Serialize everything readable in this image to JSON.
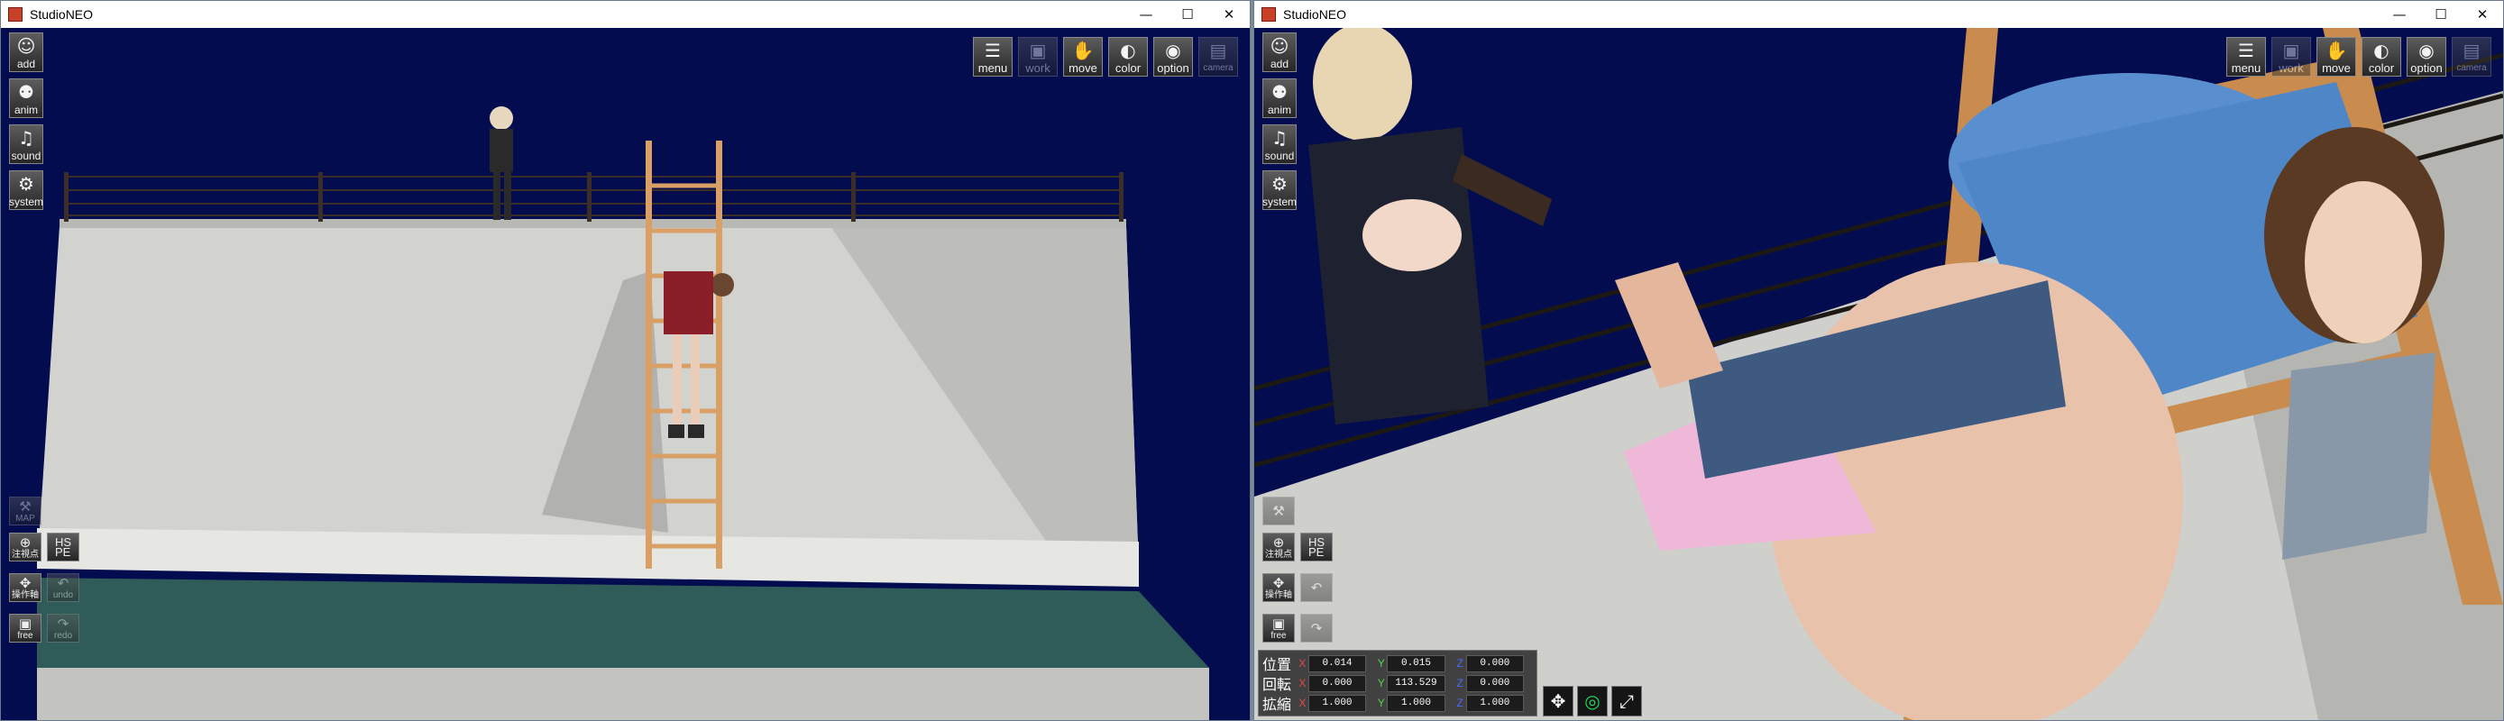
{
  "windows": [
    {
      "title": "StudioNEO",
      "controls": {
        "minimize": "—",
        "maximize": "☐",
        "close": "✕"
      },
      "left_toolbar": [
        {
          "label": "add",
          "icon": "person-add-icon",
          "glyph": "☺"
        },
        {
          "label": "anim",
          "icon": "running-figure-icon",
          "glyph": "⚉"
        },
        {
          "label": "sound",
          "icon": "music-note-icon",
          "glyph": "♫"
        },
        {
          "label": "system",
          "icon": "gears-icon",
          "glyph": "⚙"
        }
      ],
      "bottom_tools": {
        "map": "MAP",
        "center": "注視点",
        "hspe": "HS\nPE",
        "operation": "操作軸",
        "undo": "undo",
        "free": "free",
        "redo": "redo"
      },
      "top_toolbar": [
        {
          "label": "menu",
          "icon": "menu-list-icon",
          "glyph": "☰",
          "dim": false
        },
        {
          "label": "work",
          "icon": "work-icon",
          "glyph": "▣",
          "dim": true
        },
        {
          "label": "move",
          "icon": "hand-icon",
          "glyph": "✋",
          "dim": false
        },
        {
          "label": "color",
          "icon": "palette-icon",
          "glyph": "◐",
          "dim": false
        },
        {
          "label": "option",
          "icon": "eye-icon",
          "glyph": "◉",
          "dim": false
        },
        {
          "label": "camera",
          "icon": "camera-icon",
          "glyph": "▤",
          "dim": true
        }
      ]
    },
    {
      "title": "StudioNEO",
      "controls": {
        "minimize": "—",
        "maximize": "☐",
        "close": "✕"
      },
      "left_toolbar": [
        {
          "label": "add",
          "icon": "person-add-icon",
          "glyph": "☺"
        },
        {
          "label": "anim",
          "icon": "running-figure-icon",
          "glyph": "⚉"
        },
        {
          "label": "sound",
          "icon": "music-note-icon",
          "glyph": "♫"
        },
        {
          "label": "system",
          "icon": "gears-icon",
          "glyph": "⚙"
        }
      ],
      "bottom_tools": {
        "map": "",
        "center": "注視点",
        "hspe": "HS\nPE",
        "operation": "操作軸",
        "undo": "",
        "free": "free",
        "redo": ""
      },
      "top_toolbar": [
        {
          "label": "menu",
          "icon": "menu-list-icon",
          "glyph": "☰",
          "dim": false
        },
        {
          "label": "work",
          "icon": "work-icon",
          "glyph": "▣",
          "dim": true
        },
        {
          "label": "move",
          "icon": "hand-icon",
          "glyph": "✋",
          "dim": false
        },
        {
          "label": "color",
          "icon": "palette-icon",
          "glyph": "◐",
          "dim": false
        },
        {
          "label": "option",
          "icon": "eye-icon",
          "glyph": "◉",
          "dim": false
        },
        {
          "label": "camera",
          "icon": "camera-icon",
          "glyph": "▤",
          "dim": true
        }
      ],
      "transform": {
        "position": {
          "label": "位置",
          "x": "0.014",
          "y": "0.015",
          "z": "0.000"
        },
        "rotation": {
          "label": "回転",
          "x": "0.000",
          "y": "113.529",
          "z": "0.000"
        },
        "scale": {
          "label": "拡縮",
          "x": "1.000",
          "y": "1.000",
          "z": "1.000"
        }
      }
    }
  ]
}
